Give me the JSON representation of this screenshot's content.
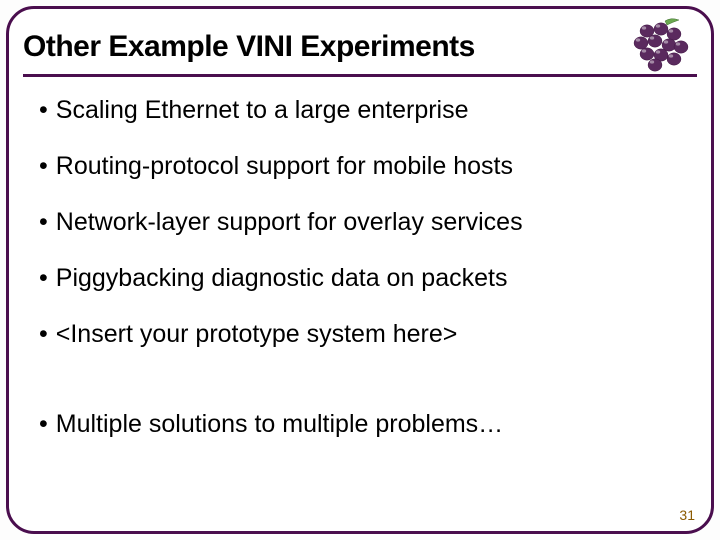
{
  "title": "Other Example VINI Experiments",
  "bullets": [
    "Scaling Ethernet to a large enterprise",
    "Routing-protocol support for mobile hosts",
    "Network-layer support for overlay services",
    "Piggybacking diagnostic data on packets",
    "<Insert your prototype system here>",
    "Multiple solutions to multiple problems…"
  ],
  "page_number": "31",
  "logo_alt": "grapes-icon",
  "colors": {
    "frame": "#4a0e4e",
    "grape": "#5a2a5e"
  }
}
